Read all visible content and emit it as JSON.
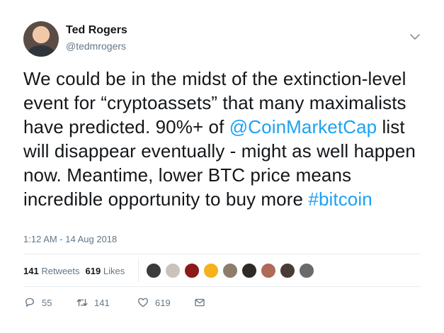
{
  "author": {
    "name": "Ted Rogers",
    "handle": "@tedmrogers"
  },
  "tweet": {
    "text_part1": "We could be in the midst of the extinction-level event for “cryptoassets” that many maximalists have predicted.  90%+ of ",
    "mention": "@CoinMarketCap",
    "text_part2": " list will disappear eventually - might as well happen now. Meantime, lower BTC price means incredible opportunity to buy more ",
    "hashtag": "#bitcoin",
    "timestamp": "1:12 AM - 14 Aug 2018"
  },
  "stats": {
    "retweets_count": "141",
    "retweets_label": "Retweets",
    "likes_count": "619",
    "likes_label": "Likes"
  },
  "likers": [
    {
      "color": "#3b3b3b"
    },
    {
      "color": "#c9c3bb"
    },
    {
      "color": "#8b1a1a"
    },
    {
      "color": "#f5b21b"
    },
    {
      "color": "#8c7d6d"
    },
    {
      "color": "#2e2a28"
    },
    {
      "color": "#b06a5a"
    },
    {
      "color": "#4a3b36"
    },
    {
      "color": "#6a6a6a"
    }
  ],
  "actions": {
    "replies": "55",
    "retweets": "141",
    "likes": "619"
  },
  "colors": {
    "link": "#1da1f2",
    "secondary_text": "#657786",
    "divider": "#e6ecf0"
  }
}
